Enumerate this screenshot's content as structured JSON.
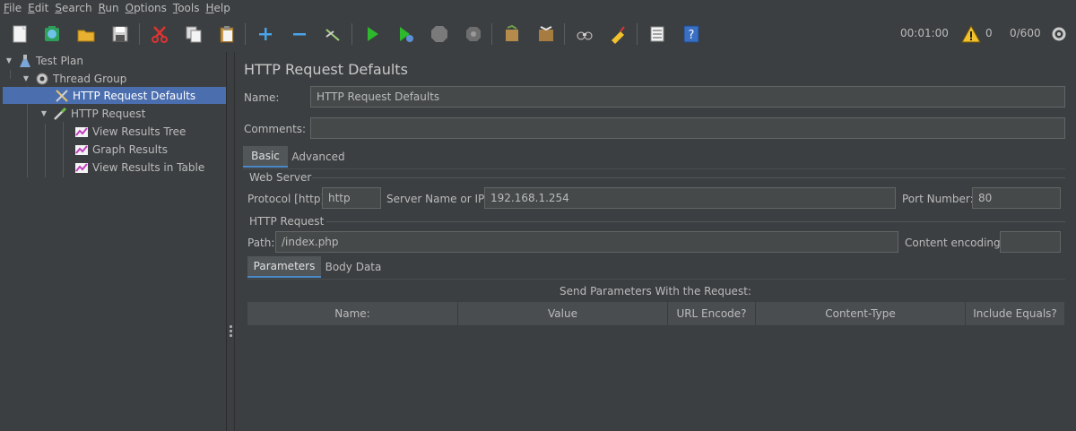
{
  "menu": [
    "File",
    "Edit",
    "Search",
    "Run",
    "Options",
    "Tools",
    "Help"
  ],
  "toolbar": {
    "timer": "00:01:00",
    "warnings": "0",
    "threads": "0/600"
  },
  "tree": {
    "items": [
      {
        "label": "Test Plan"
      },
      {
        "label": "Thread Group"
      },
      {
        "label": "HTTP Request Defaults"
      },
      {
        "label": "HTTP Request"
      },
      {
        "label": "View Results Tree"
      },
      {
        "label": "Graph Results"
      },
      {
        "label": "View Results in Table"
      }
    ]
  },
  "panel": {
    "title": "HTTP Request Defaults",
    "name_label": "Name:",
    "name_value": "HTTP Request Defaults",
    "comments_label": "Comments:",
    "comments_value": "",
    "tabs": [
      "Basic",
      "Advanced"
    ],
    "web_server": {
      "legend": "Web Server",
      "protocol_label": "Protocol [http]:",
      "protocol_value": "http",
      "server_label": "Server Name or IP:",
      "server_value": "192.168.1.254",
      "port_label": "Port Number:",
      "port_value": "80"
    },
    "http_request": {
      "legend": "HTTP Request",
      "path_label": "Path:",
      "path_value": "/index.php",
      "encoding_label": "Content encoding:",
      "encoding_value": ""
    },
    "subtabs": [
      "Parameters",
      "Body Data"
    ],
    "params_caption": "Send Parameters With the Request:",
    "params_columns": [
      "Name:",
      "Value",
      "URL Encode?",
      "Content-Type",
      "Include Equals?"
    ]
  },
  "colors": {
    "background": "#3c3f41",
    "selection": "#4b6eaf",
    "accent": "#4a88c7"
  }
}
